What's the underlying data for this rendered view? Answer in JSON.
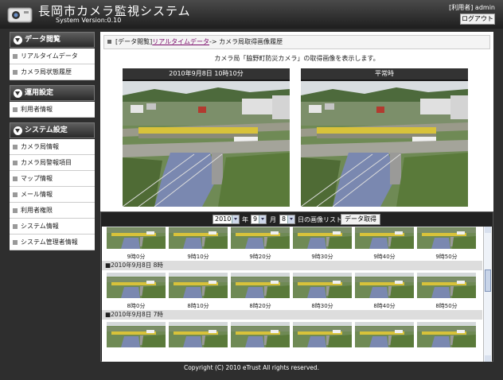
{
  "header": {
    "title": "長岡市カメラ監視システム",
    "version": "System Version:0.10",
    "user_info": "[利用者] admin",
    "logout_label": "ログアウト"
  },
  "sidebar": {
    "sections": [
      {
        "label": "データ閲覧",
        "items": [
          "リアルタイムデータ",
          "カメラ局状態履歴"
        ]
      },
      {
        "label": "運用設定",
        "items": [
          "利用者情報"
        ]
      },
      {
        "label": "システム設定",
        "items": [
          "カメラ局情報",
          "カメラ局警報項目",
          "マップ情報",
          "メール情報",
          "利用者権限",
          "システム情報",
          "システム管理者情報"
        ]
      }
    ]
  },
  "breadcrumb": {
    "prefix": "[データ閲覧]",
    "link": "リアルタイムデータ",
    "current": "-> カメラ局取得画像履歴"
  },
  "description": "カメラ局「脇野町防災カメラ」の取得画像を表示します。",
  "camera": {
    "left_caption": "2010年9月8日 10時10分",
    "right_caption": "平常時"
  },
  "list": {
    "year": "2010",
    "year_suffix": "年",
    "month": "9",
    "month_suffix": "月",
    "day": "8",
    "day_suffix": "日の画像リスト",
    "fetch_label": "データ取得",
    "top_row": [
      "9時0分",
      "9時10分",
      "9時20分",
      "9時30分",
      "9時40分",
      "9時50分"
    ],
    "groups": [
      {
        "heading": "■2010年9月8日 8時",
        "thumbs": [
          "8時0分",
          "8時10分",
          "8時20分",
          "8時30分",
          "8時40分",
          "8時50分"
        ]
      },
      {
        "heading": "■2010年9月8日 7時",
        "thumbs": [
          "",
          "",
          "",
          "",
          "",
          ""
        ]
      }
    ]
  },
  "footer": "Copyright (C) 2010 eTrust All rights reserved.",
  "colors": {
    "link": "#7a0a6a",
    "header_bg": "#2e2e2e"
  }
}
